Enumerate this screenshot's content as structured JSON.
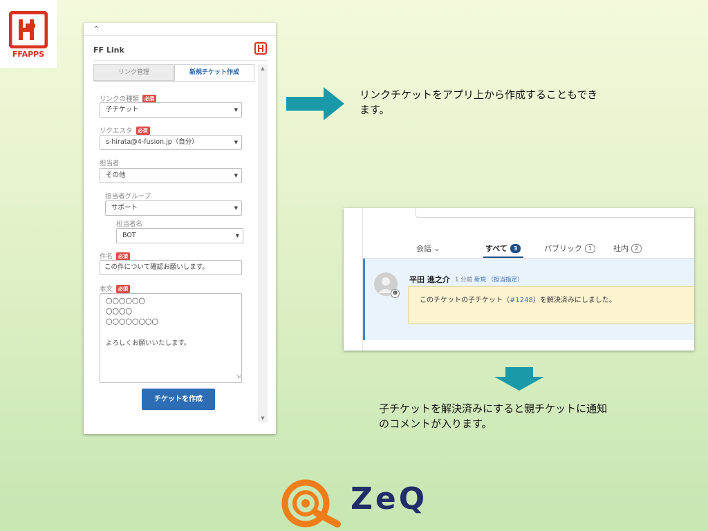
{
  "colors": {
    "accent_teal": "#1a9aa8",
    "primary_button": "#2c6db5",
    "required_badge": "#e04b4b",
    "ffapps_red": "#d9321c",
    "zeq_navy": "#1f2d68",
    "zeq_orange": "#ef7d1a"
  },
  "logo": {
    "ffapps_text": "FFAPPS",
    "zeq_text": "ZeQ"
  },
  "panel": {
    "collapse_icon": "chevron-up-icon",
    "app_title": "FF Link",
    "app_icon": "ffapps-app-icon",
    "tabs": [
      "リンク管理",
      "新規チケット作成"
    ],
    "required_badge": "必須",
    "fields": {
      "link_type": {
        "label": "リンクの種類",
        "value": "子チケット"
      },
      "requester": {
        "label": "リクエスタ",
        "value": "s-hirata@4-fusion.jp（自分）"
      },
      "assignee": {
        "label": "担当者",
        "value": "その他"
      },
      "assignee_group": {
        "label": "担当者グループ",
        "value": "サポート"
      },
      "assignee_name": {
        "label": "担当者名",
        "value": "BOT"
      },
      "subject": {
        "label": "件名",
        "value": "この件について確認お願いします。"
      },
      "body": {
        "label": "本文",
        "lines": [
          "〇〇〇〇〇〇",
          "〇〇〇〇",
          "〇〇〇〇〇〇〇〇",
          "",
          "よろしくお願いいたします。"
        ]
      }
    },
    "create_button": "チケットを作成"
  },
  "text1": {
    "line1": "リンクチケットをアプリ上から作成することもでき",
    "line2": "ます。"
  },
  "text2": {
    "line1": "子チケットを解決済みにすると親チケットに通知",
    "line2": "のコメントが入ります。"
  },
  "conversation": {
    "filter_label": "会話 ⌄",
    "tabs": [
      {
        "label": "すべて",
        "count": "3"
      },
      {
        "label": "パブリック",
        "count": "1"
      },
      {
        "label": "社内",
        "count": "2"
      }
    ],
    "comment": {
      "author": "平田 進之介",
      "time": "1 分前",
      "status": "新規",
      "assign_note": "（担当指定）",
      "message_before": "このチケットの子チケット（",
      "ticket_number": "#1248",
      "message_after": "）を解決済みにしました。"
    }
  }
}
